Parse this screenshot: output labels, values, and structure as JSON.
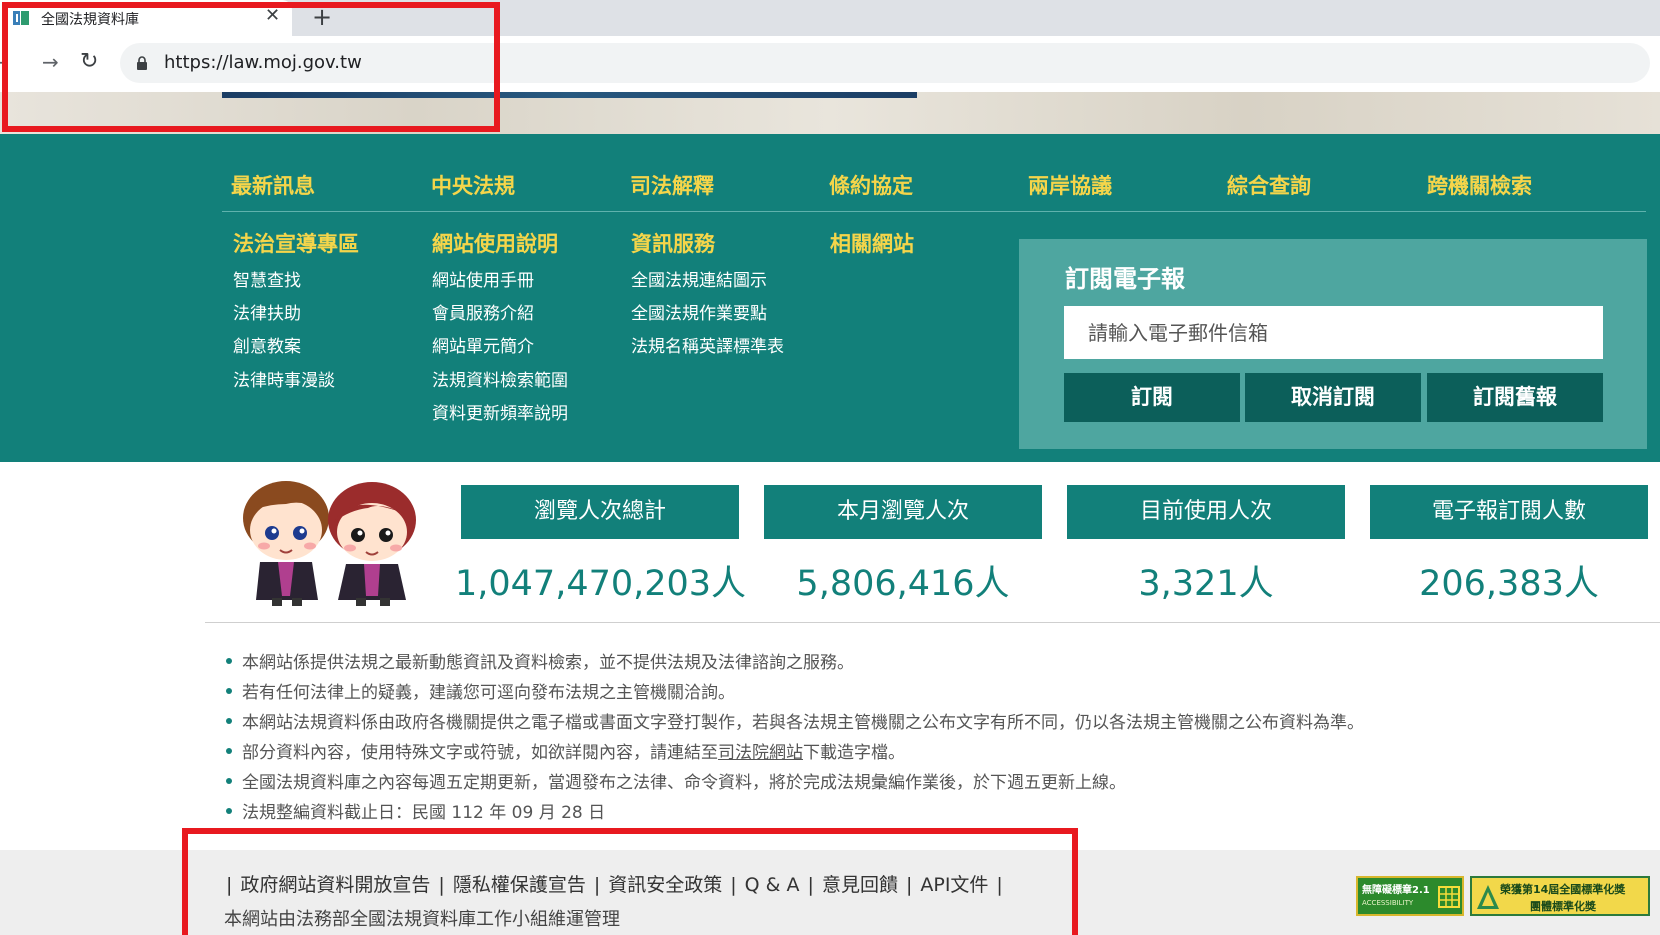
{
  "browser": {
    "tab_title": "全國法規資料庫",
    "tab_close": "✕",
    "new_tab": "+",
    "back": "←",
    "forward": "→",
    "reload": "↻",
    "url": "https://law.moj.gov.tw"
  },
  "main_nav": [
    "最新訊息",
    "中央法規",
    "司法解釋",
    "條約協定",
    "兩岸協議",
    "綜合查詢",
    "跨機關檢索"
  ],
  "columns": [
    {
      "title": "法治宣導專區",
      "links": [
        "智慧查找",
        "法律扶助",
        "創意教案",
        "法律時事漫談"
      ]
    },
    {
      "title": "網站使用說明",
      "links": [
        "網站使用手冊",
        "會員服務介紹",
        "網站單元簡介",
        "法規資料檢索範圍",
        "資料更新頻率說明"
      ]
    },
    {
      "title": "資訊服務",
      "links": [
        "全國法規連結圖示",
        "全國法規作業要點",
        "法規名稱英譯標準表"
      ]
    },
    {
      "title": "相關網站",
      "links": []
    }
  ],
  "subscribe": {
    "title": "訂閱電子報",
    "placeholder": "請輸入電子郵件信箱",
    "buttons": [
      "訂閱",
      "取消訂閱",
      "訂閱舊報"
    ]
  },
  "stats": [
    {
      "label": "瀏覽人次總計",
      "value": "1,047,470,203人"
    },
    {
      "label": "本月瀏覽人次",
      "value": "5,806,416人"
    },
    {
      "label": "目前使用人次",
      "value": "3,321人"
    },
    {
      "label": "電子報訂閱人數",
      "value": "206,383人"
    }
  ],
  "notices": {
    "n1": "本網站係提供法規之最新動態資訊及資料檢索，並不提供法規及法律諮詢之服務。",
    "n2": "若有任何法律上的疑義，建議您可逕向發布法規之主管機關洽詢。",
    "n3": "本網站法規資料係由政府各機關提供之電子檔或書面文字登打製作，若與各法規主管機關之公布文字有所不同，仍以各法規主管機關之公布資料為準。",
    "n4_before": "部分資料內容，使用特殊文字或符號，如欲詳閱內容，請連結至",
    "n4_link": "司法院網站",
    "n4_after": "下載造字檔。",
    "n5": "全國法規資料庫之內容每週五定期更新，當週發布之法律、命令資料，將於完成法規彙編作業後，於下週五更新上線。",
    "n6": "法規整編資料截止日：民國 112 年 09 月 28 日"
  },
  "footer": {
    "separator": "|",
    "links": [
      "政府網站資料開放宣告",
      "隱私權保護宣告",
      "資訊安全政策",
      "Q & A",
      "意見回饋",
      "API文件"
    ],
    "note": "本網站由法務部全國法規資料庫工作小組維運管理"
  },
  "badges": {
    "accessibility": "無障礙標章2.1",
    "accessibility_sub": "ACCESSIBILITY",
    "award_line1": "榮獲第14屆全國標準化獎",
    "award_line2": "團體標準化獎"
  },
  "colors": {
    "primary_teal": "#12807a",
    "nav_gold": "#f5d54a",
    "annotation_red": "#e8191f"
  }
}
